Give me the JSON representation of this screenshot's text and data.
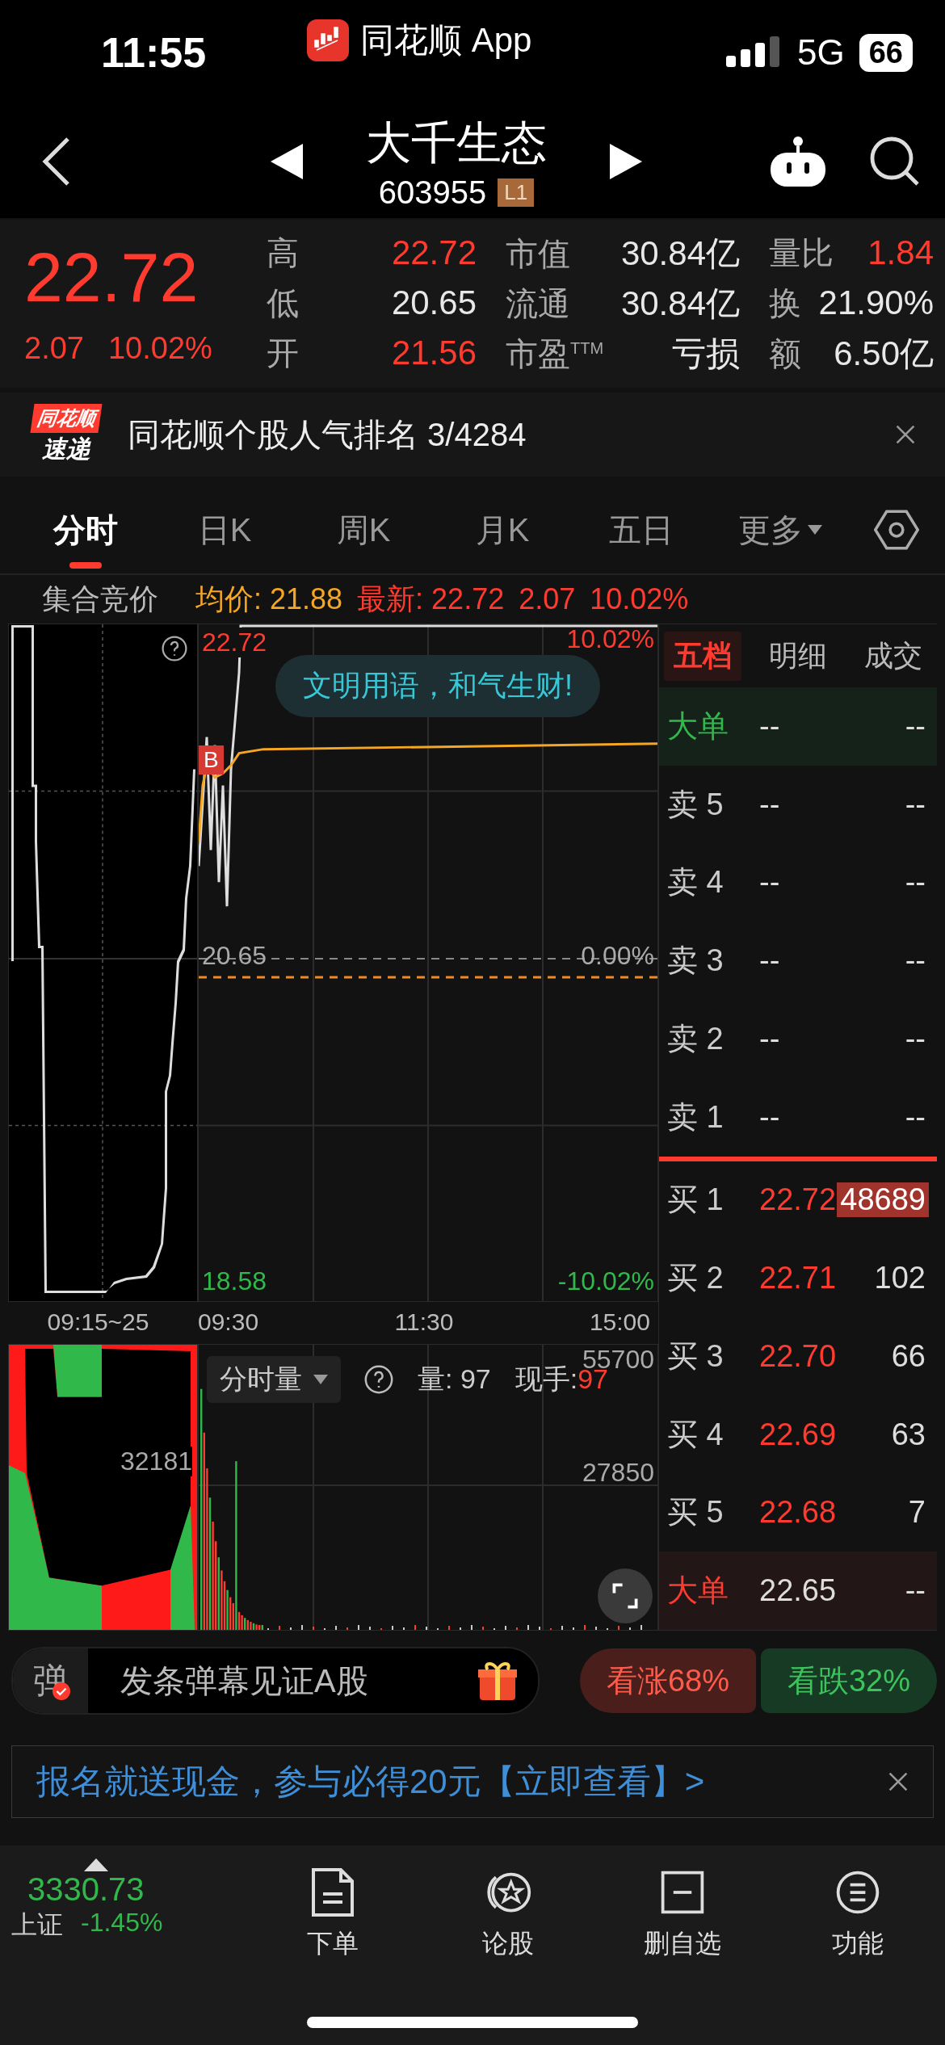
{
  "status_bar": {
    "time": "11:55",
    "app": "同花顺 App",
    "network": "5G",
    "battery": "66"
  },
  "header": {
    "name": "大千生态",
    "code": "603955",
    "badge": "L1"
  },
  "quote": {
    "price": "22.72",
    "change": "2.07",
    "change_pct": "10.02%",
    "stats": [
      {
        "label": "高",
        "value": "22.72",
        "rising": true
      },
      {
        "label": "市值",
        "value": "30.84亿",
        "rising": false
      },
      {
        "label": "量比",
        "value": "1.84",
        "rising": true
      },
      {
        "label": "低",
        "value": "20.65",
        "rising": false
      },
      {
        "label": "流通",
        "value": "30.84亿",
        "rising": false
      },
      {
        "label": "换",
        "value": "21.90%",
        "rising": false
      },
      {
        "label": "开",
        "value": "21.56",
        "rising": true
      },
      {
        "label": "市盈$^{TTM}$",
        "value": "亏损",
        "rising": false
      },
      {
        "label": "额",
        "value": "6.50亿",
        "rising": false
      }
    ]
  },
  "notice": {
    "brand_top": "同花顺",
    "brand_bottom": "速递",
    "text": "同花顺个股人气排名 3/4284"
  },
  "tabs": [
    {
      "label": "分时",
      "selected": true,
      "kind": "plain"
    },
    {
      "label": "日K",
      "selected": false,
      "kind": "plain"
    },
    {
      "label": "周K",
      "selected": false,
      "kind": "plain"
    },
    {
      "label": "月K",
      "selected": false,
      "kind": "plain"
    },
    {
      "label": "五日",
      "selected": false,
      "kind": "plain"
    },
    {
      "label": "更多",
      "selected": false,
      "kind": "dropdown"
    }
  ],
  "chart_header": {
    "label": "集合竞价",
    "avg": "均价: 21.88",
    "latest": "最新: 22.72",
    "change": "2.07",
    "change_pct": "10.02%"
  },
  "price_chart": {
    "top_price": "22.72",
    "top_pct": "10.02%",
    "mid_price": "20.65",
    "mid_pct": "0.00%",
    "low_price": "18.58",
    "low_pct": "-10.02%",
    "bubble": "文明用语，和气生财!",
    "marker": "B",
    "times": [
      "09:15~25",
      "09:30",
      "11:30",
      "15:00"
    ]
  },
  "volume_chart": {
    "selector": "分时量",
    "volume": "量: 97",
    "hand_label": "现手:",
    "hand_value": "97",
    "top_tick": "55700",
    "mid_tick": "27850",
    "auction_tick": "32181"
  },
  "order_book": {
    "tabs": [
      {
        "label": "五档",
        "selected": true
      },
      {
        "label": "明细",
        "selected": false
      },
      {
        "label": "成交",
        "selected": false
      }
    ],
    "rows": [
      {
        "label": "大单",
        "price": "--",
        "volume": "--",
        "kind": "big_sell",
        "highlight": false
      },
      {
        "label": "卖 5",
        "price": "--",
        "volume": "--",
        "kind": "sell",
        "highlight": false
      },
      {
        "label": "卖 4",
        "price": "--",
        "volume": "--",
        "kind": "sell",
        "highlight": false
      },
      {
        "label": "卖 3",
        "price": "--",
        "volume": "--",
        "kind": "sell",
        "highlight": false
      },
      {
        "label": "卖 2",
        "price": "--",
        "volume": "--",
        "kind": "sell",
        "highlight": false
      },
      {
        "label": "卖 1",
        "price": "--",
        "volume": "--",
        "kind": "sell",
        "highlight": false
      },
      {
        "label": "买 1",
        "price": "22.72",
        "volume": "48689",
        "kind": "buy",
        "highlight": true
      },
      {
        "label": "买 2",
        "price": "22.71",
        "volume": "102",
        "kind": "buy",
        "highlight": false
      },
      {
        "label": "买 3",
        "price": "22.70",
        "volume": "66",
        "kind": "buy",
        "highlight": false
      },
      {
        "label": "买 4",
        "price": "22.69",
        "volume": "63",
        "kind": "buy",
        "highlight": false
      },
      {
        "label": "买 5",
        "price": "22.68",
        "volume": "7",
        "kind": "buy",
        "highlight": false
      },
      {
        "label": "大单",
        "price": "22.65",
        "volume": "--",
        "kind": "big_buy",
        "highlight": false
      }
    ]
  },
  "danmaku": {
    "icon": "弹",
    "placeholder": "发条弹幕见证A股"
  },
  "sentiment": [
    {
      "label": "看涨68%",
      "kind": "bull"
    },
    {
      "label": "看跌32%",
      "kind": "bear"
    }
  ],
  "promo": {
    "text": "报名就送现金，参与必得20元【立即查看】>"
  },
  "bottom_bar": {
    "index": {
      "value": "3330.73",
      "name": "上证",
      "change": "-1.45%"
    },
    "items": [
      {
        "label": "下单",
        "kind": "order"
      },
      {
        "label": "论股",
        "kind": "discuss"
      },
      {
        "label": "删自选",
        "kind": "remove"
      },
      {
        "label": "功能",
        "kind": "menu"
      }
    ]
  }
}
